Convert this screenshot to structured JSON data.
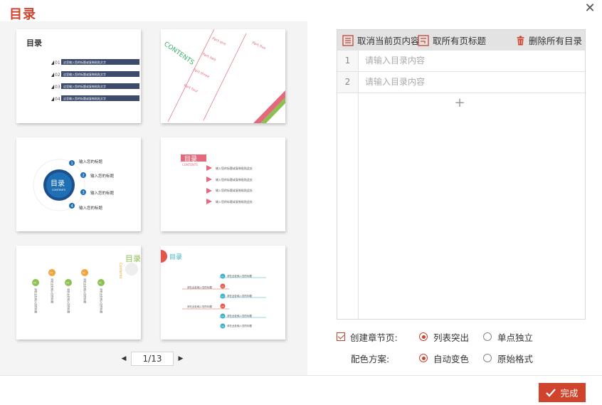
{
  "dialog": {
    "title": "目录",
    "close_label": "✕"
  },
  "thumbnails": [
    {
      "id": "toc-template-1",
      "heading": "目录",
      "items": [
        "01",
        "02",
        "03",
        "04"
      ],
      "item_text": "这里输入您的标题或复制粘贴文字"
    },
    {
      "id": "toc-template-2",
      "heading": "CONTENTS",
      "items": [
        "Part one",
        "Part two",
        "Part three",
        "Part four",
        "Part five"
      ]
    },
    {
      "id": "toc-template-3",
      "heading": "目录",
      "subheading": "CONTENTS",
      "items": [
        "1",
        "2",
        "3",
        "4"
      ],
      "item_text": "输入您的标题"
    },
    {
      "id": "toc-template-4",
      "heading": "目录",
      "subheading": "CONTENTS",
      "item_text": "输入您的标题或复制粘贴此处"
    },
    {
      "id": "toc-template-5",
      "heading": "目录",
      "subheading": "Contents",
      "items": [
        "05",
        "04",
        "03",
        "02",
        "01"
      ],
      "item_text": "请在此处输入您的标题"
    },
    {
      "id": "toc-template-6",
      "heading": "目录",
      "items": [
        "01",
        "02",
        "03",
        "04",
        "05",
        "06"
      ],
      "item_text": "请在此处输入您的标题"
    }
  ],
  "pager": {
    "prev": "◀",
    "page": "1/13",
    "next": "▶"
  },
  "toolbar": {
    "cancel_current": "取消当前页内容",
    "cancel_all_titles": "取所有页标题",
    "delete_all": "删除所有目录"
  },
  "rows": [
    {
      "num": "1",
      "placeholder": "请输入目录内容"
    },
    {
      "num": "2",
      "placeholder": "请输入目录内容"
    }
  ],
  "add_label": "+",
  "options": {
    "create_chapter_label": "创建章节页:",
    "create_chapter_checked": true,
    "chapter_opt1": "列表突出",
    "chapter_opt2": "单点独立",
    "chapter_selected": "列表突出",
    "color_label": "配色方案:",
    "color_opt1": "自动变色",
    "color_opt2": "原始格式",
    "color_selected": "自动变色"
  },
  "done_label": "完成",
  "colors": {
    "accent": "#d0442e",
    "navy": "#3c4a6b",
    "blue": "#1f6fb5",
    "pink": "#e26a7a",
    "green": "#8cc152"
  }
}
